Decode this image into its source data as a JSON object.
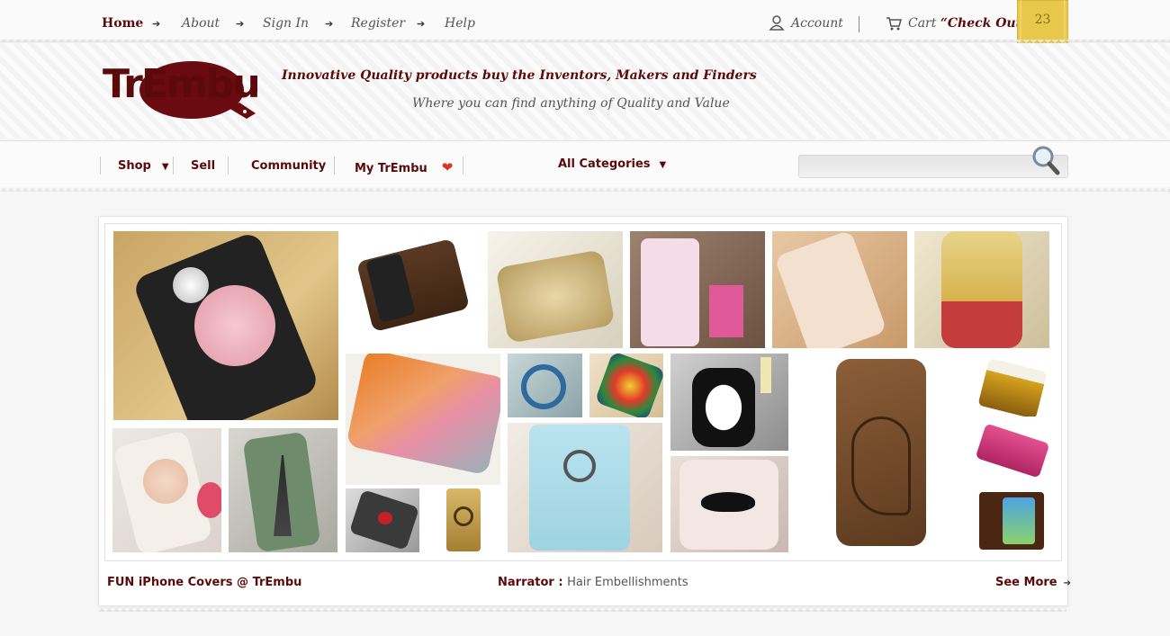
{
  "topbar": {
    "links": [
      "Home",
      "About",
      "Sign In",
      "Register",
      "Help"
    ],
    "account": "Account",
    "cart_prefix": "Cart ",
    "cart_action": "“Check Out”",
    "badge_count": "23"
  },
  "header": {
    "logo_text": "TrEmbu",
    "tagline": "Innovative Quality products buy the Inventors, Makers and Finders",
    "subtagline": "Where you can find anything of Quality and Value"
  },
  "nav": {
    "shop": "Shop",
    "sell": "Sell",
    "community": "Community",
    "my": "My TrEmbu",
    "categories": "All Categories",
    "search_placeholder": ""
  },
  "gallery": {
    "caption_left": "FUN iPhone Covers @ TrEmbu",
    "narrator_label": "Narrator : ",
    "narrator_value": "Hair Embellishments",
    "see_more": "See More"
  },
  "colors": {
    "brand": "#5a0a0a",
    "badge": "#e8c84a"
  }
}
